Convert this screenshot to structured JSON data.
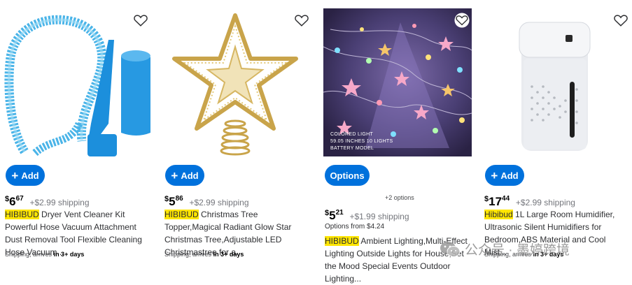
{
  "colors": {
    "primary": "#0071dc",
    "brand_highlight": "#ffe600",
    "shipping_text": "#74767c"
  },
  "products": [
    {
      "image": "blue-dryer-vent-hose",
      "action_label": "Add",
      "price": {
        "dollars": "6",
        "cents": "67"
      },
      "shipping": "+$2.99 shipping",
      "brand": "HIBIBUD",
      "title": "Dryer Vent Cleaner Kit Powerful Hose Vacuum Attachment Dust Removal Tool Flexible Cleaning Hose Vacuum...",
      "delivery_prefix": "Shipping, arrives",
      "delivery_bold": "in 3+ days"
    },
    {
      "image": "gold-star-tree-topper",
      "action_label": "Add",
      "price": {
        "dollars": "5",
        "cents": "86"
      },
      "shipping": "+$2.99 shipping",
      "brand": "HIBIBUD",
      "title": "Christmas Tree Topper,Magical Radiant Glow Star Christmas Tree,Adjustable LED Christmastree for a...",
      "delivery_prefix": "Shipping, arrives",
      "delivery_bold": "in 3+ days"
    },
    {
      "image": "star-string-lights",
      "image_text": [
        "COLORED LIGHT",
        "59.05 INCHES   10 LIGHTS",
        "BATTERY MODEL"
      ],
      "action_label": "Options",
      "options_count": "+2 options",
      "price": {
        "dollars": "5",
        "cents": "21"
      },
      "shipping": "+$1.99 shipping",
      "options_from": "Options from $4.24",
      "brand": "HIBIBUD",
      "title": "Ambient Lighting,Multi-Effect Lighting Outside Lights for House,Set the Mood Special Events Outdoor Lighting..."
    },
    {
      "image": "white-humidifier",
      "action_label": "Add",
      "price": {
        "dollars": "17",
        "cents": "44"
      },
      "shipping": "+$2.99 shipping",
      "brand": "Hibibud",
      "title": "1L Large Room Humidifier, Ultrasonic Silent Humidifiers for Bedroom,ABS Material and Cool Mist...",
      "delivery_prefix": "Shipping, arrives",
      "delivery_bold": "in 3+ days"
    }
  ],
  "watermark": "公众号 · 墨婷跨境"
}
